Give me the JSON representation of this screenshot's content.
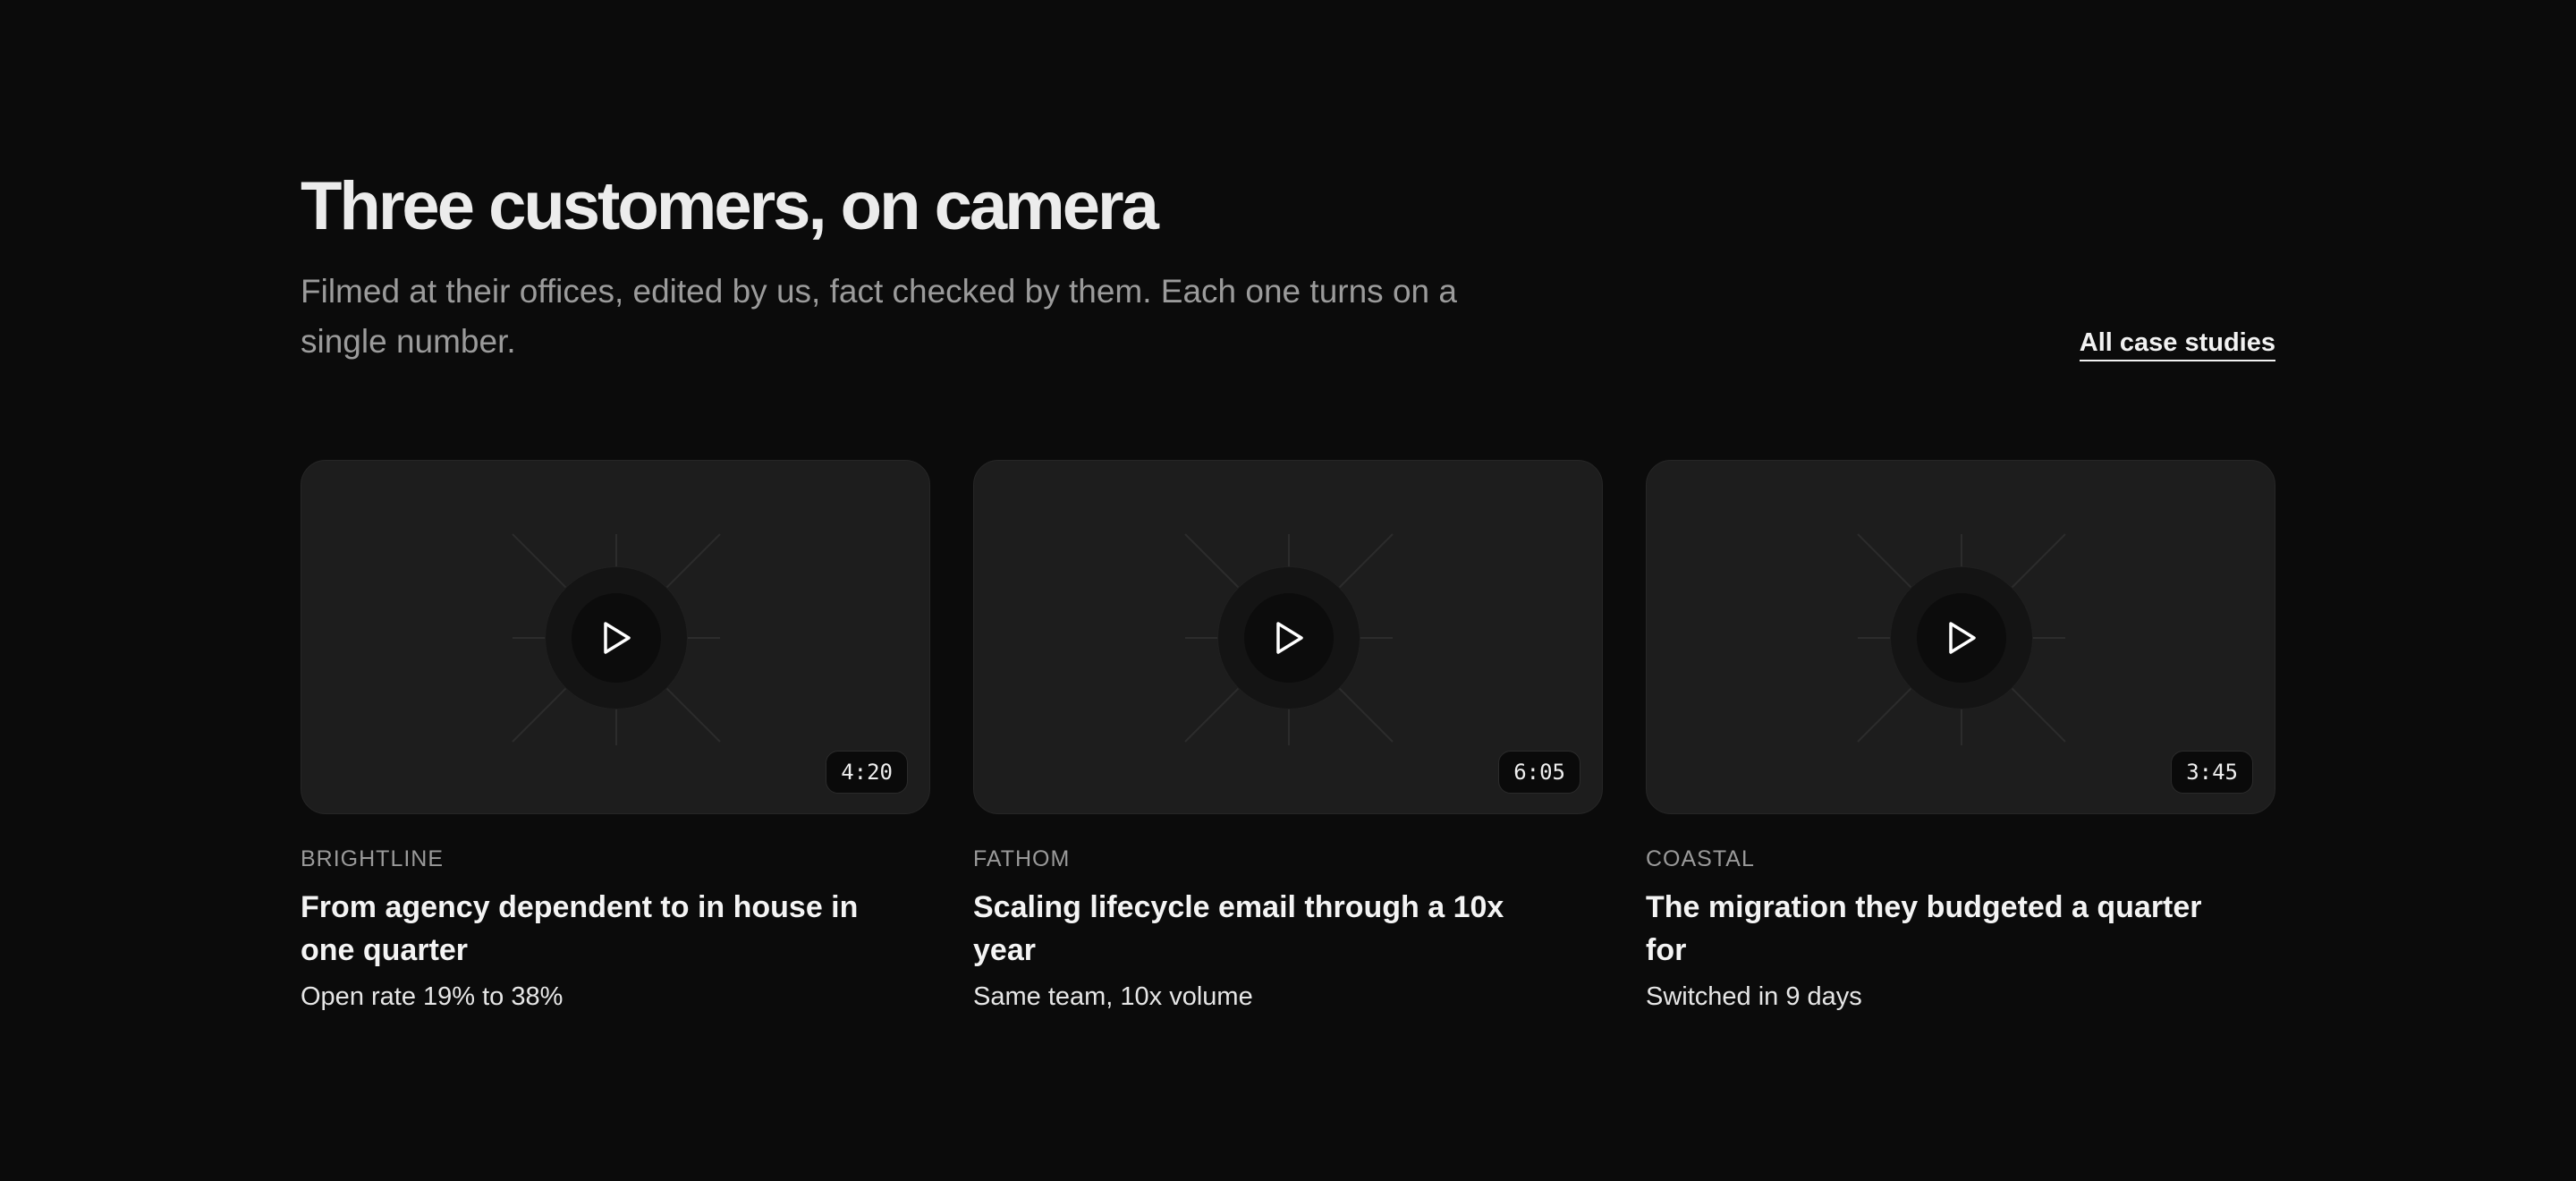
{
  "section": {
    "title": "Three customers, on camera",
    "subtitle": "Filmed at their offices, edited by us, fact checked by them. Each one turns on a single number.",
    "all_link": "All case studies"
  },
  "cards": [
    {
      "company": "BRIGHTLINE",
      "title": "From agency dependent to in house in one quarter",
      "metric": "Open rate 19% to 38%",
      "duration": "4:20",
      "icon": "play-icon"
    },
    {
      "company": "FATHOM",
      "title": "Scaling lifecycle email through a 10x year",
      "metric": "Same team, 10x volume",
      "duration": "6:05",
      "icon": "play-icon"
    },
    {
      "company": "COASTAL",
      "title": "The migration they budgeted a quarter for",
      "metric": "Switched in 9 days",
      "duration": "3:45",
      "icon": "play-icon"
    }
  ],
  "colors": {
    "background": "#0b0b0b",
    "card": "#1d1d1d",
    "text": "#ececec",
    "muted": "#9b9b9b"
  }
}
